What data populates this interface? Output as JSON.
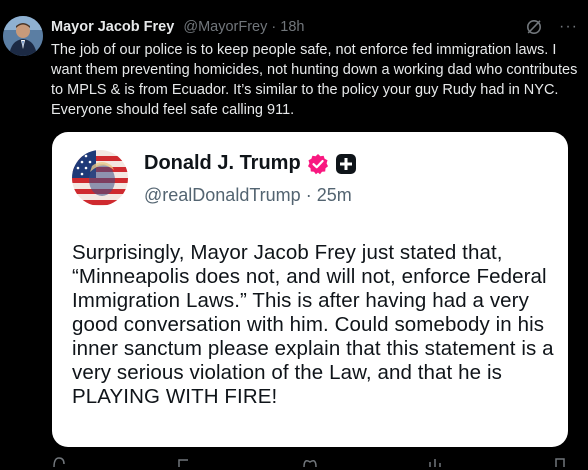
{
  "post": {
    "display_name": "Mayor Jacob Frey",
    "handle": "@MayorFrey",
    "separator": "·",
    "time": "18h",
    "text": "The job of our police is to keep people safe, not enforce fed immigration laws. I want them preventing homicides, not hunting down a working dad who contributes to MPLS & is from Ecuador. It’s similar to the policy your guy Rudy had in NYC. Everyone should feel safe calling 911."
  },
  "quoted": {
    "display_name": "Donald J. Trump",
    "handle": "@realDonaldTrump",
    "separator": "·",
    "time": "25m",
    "text": "Surprisingly, Mayor Jacob Frey just stated that, “Minneapolis does not, and will not, enforce Federal Immigration Laws.” This is after having had a very good conversation with him. Could somebody in his inner sanctum please explain that this statement is a very serious violation of the Law, and that he is PLAYING WITH FIRE!"
  },
  "colors": {
    "background": "#000000",
    "card": "#ffffff",
    "verified_badge": "#f91880",
    "muted": "#71767b"
  },
  "icons": [
    "grok-icon",
    "more-icon",
    "verified-badge-icon",
    "truth-social-icon",
    "reply-icon",
    "repost-icon",
    "like-icon",
    "views-icon",
    "bookmark-icon"
  ]
}
